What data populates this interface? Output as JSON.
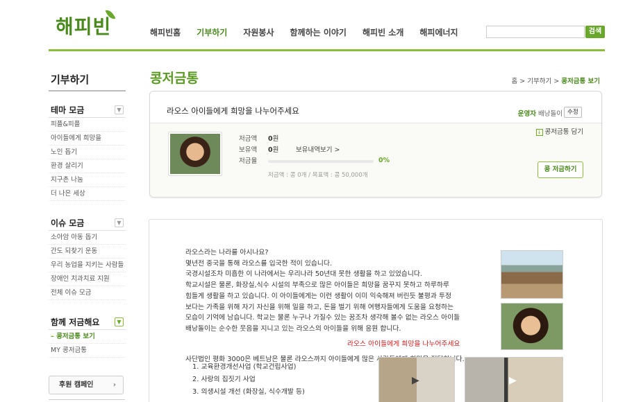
{
  "brand": {
    "logo_text": "해피빈"
  },
  "gnb": [
    "해피빈홈",
    "기부하기",
    "자원봉사",
    "함께하는 이야기",
    "해피빈 소개",
    "해피에너지"
  ],
  "search": {
    "button_label": "검색",
    "placeholder": ""
  },
  "sidebar": {
    "title": "기부하기",
    "groups": [
      {
        "label": "테마 모금",
        "items": [
          "피플&피플",
          "아이들에게 희망을",
          "노인 돕기",
          "환경 살리기",
          "지구촌 나눔",
          "더 나은 세상"
        ]
      },
      {
        "label": "이슈 모금",
        "items": [
          "소아암 아동 돕기",
          "간도 되찾기 운동",
          "우리 농업을 지키는 사람들",
          "장애인 치과치료 지원",
          "전체 이슈 모금"
        ]
      },
      {
        "label": "함께 저금해요",
        "items": [
          "콩저금통 보기",
          "MY 콩저금통"
        ]
      }
    ],
    "campaign_button": "후원 캠페인"
  },
  "main": {
    "title": "콩저금통",
    "breadcrumb": {
      "home": "홈",
      "sep": ">",
      "mid": "기부하기",
      "current": "콩저금통 보기"
    },
    "card": {
      "subtitle": "라오스 아이들에게 희망을 나누어주세요",
      "operator_label": "운영자",
      "operator_name": "배낭돌이",
      "edit_button": "수정",
      "basket_label": "콩저금통 담기",
      "saved_label": "저금액",
      "saved_value": "0",
      "unit": "원",
      "held_label": "보유액",
      "held_value": "0",
      "history_link": "보유내역보기 >",
      "rate_label": "저금율",
      "rate_value": "0%",
      "rate_fraction": 0,
      "goal_text": "저금액 : 콩 0개  /  목표액 : 콩 50,000개",
      "donate_button": "콩 저금하기"
    },
    "story": {
      "lines": [
        "라오스라는 나라를 아시나요?",
        "몇년전 중국을 통해 라오스를 입국한 적이 있습니다.",
        "국경시설조차 미흡한 이 나라에서는 우리나라 50년대 못한 생활을 하고 있었습니다.",
        "학교시설은 물론, 화장실,식수 시설의 부족으로 많은 아이들은 희망을 꿈꾸지 못하고 하루하루",
        "힘들게 생활을 하고 있습니다. 이 아이들에게는 이런 생활이 이미 익숙해져 버린듯 불평과 투정",
        "보다는 가족을 위해 자기 자신을 위해 일을 하고, 돈을 벌기 위해 여행자들에게 도움을 요청하는",
        "모습이 기억에 남습니다. 학교는 물론 누구나 가질수 있는 꿈조차 생각해 볼수 없는 라오스 아이들",
        "배낭돌이는 순수한 웃음을 지니고 있는 라오스의 아이들을 위해 응원 합니다."
      ],
      "highlight": "라오스 아이들에게 희망을 나누어주세요",
      "intro": "사단법인 평화 3000은 베트남은 물론 라오스까지 아이들에게 많은 사람들에게 희망을 전달합니다.",
      "projects": [
        "1. 교육환경개선사업 (학교건립사업)",
        "2. 사랑의 집짓기 사업",
        "3. 의생시설 개선 (화장실, 식수개발 등)"
      ]
    }
  },
  "colors": {
    "brand_green": "#4b8a1f",
    "accent_green": "#8cbc3c",
    "highlight_red": "#d11a1a"
  }
}
